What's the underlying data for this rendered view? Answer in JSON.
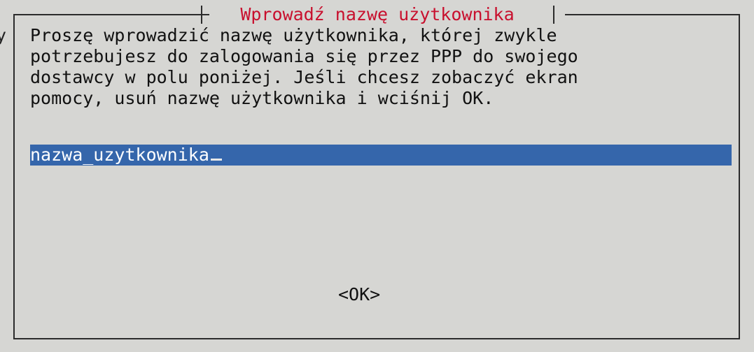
{
  "dialog": {
    "title": "Wprowadź nazwę użytkownika",
    "message": "Proszę wprowadzić nazwę użytkownika, której zwykle\npotrzebujesz do zalogowania się przez PPP do swojego\ndostawcy w polu poniżej. Jeśli chcesz zobaczyć ekran\npomocy, usuń nazwę użytkownika i wciśnij OK.",
    "input": {
      "value": "nazwa_uzytkownika"
    },
    "ok_label": "<OK>"
  },
  "colors": {
    "background": "#d6d6d3",
    "title": "#c8102e",
    "input_background": "#3566ab",
    "input_text": "#ffffff",
    "border": "#2b2b2b"
  }
}
